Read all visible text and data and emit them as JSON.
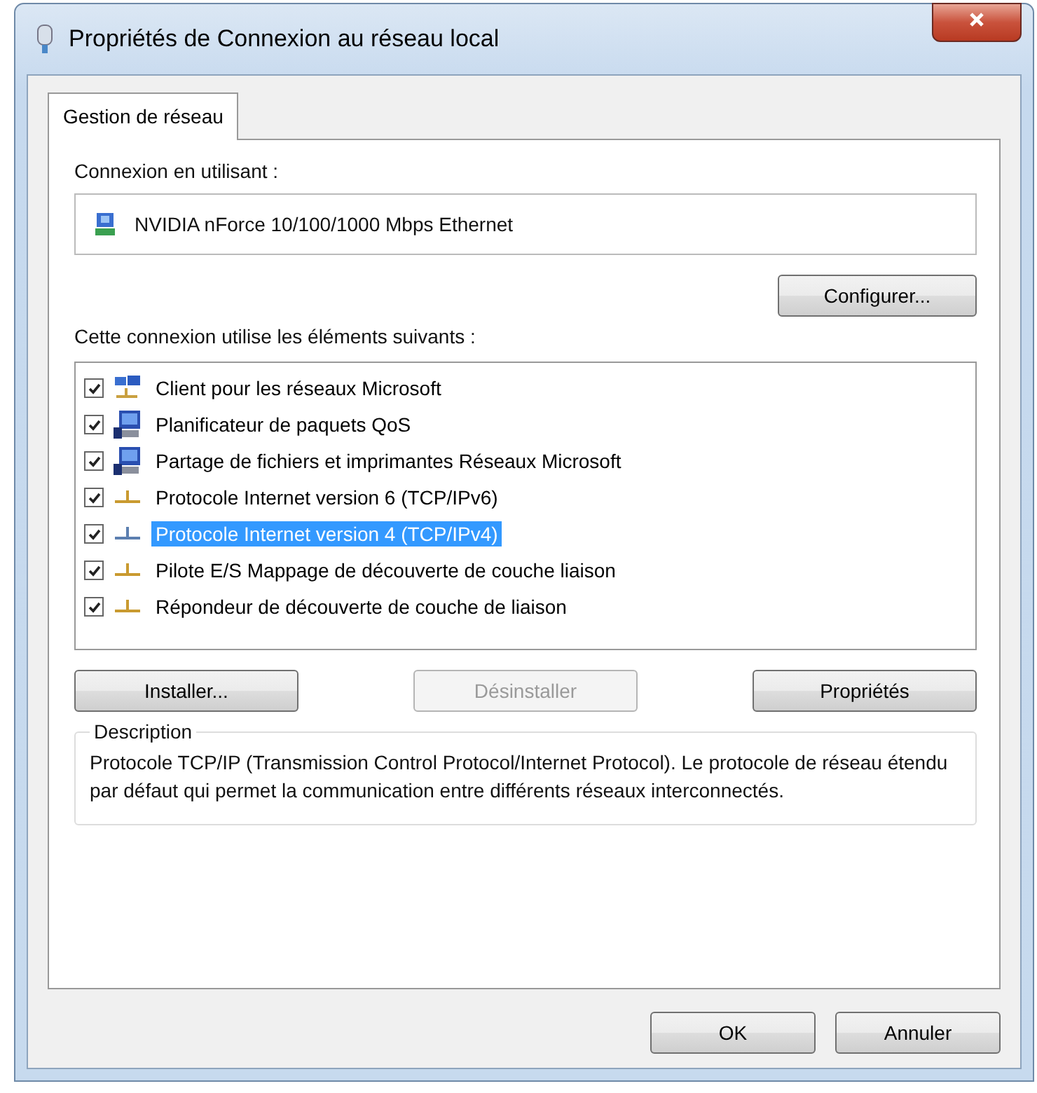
{
  "window": {
    "title": "Propriétés de Connexion au réseau local"
  },
  "tabs": [
    {
      "label": "Gestion de réseau",
      "selected": true
    }
  ],
  "connect_using": {
    "label": "Connexion en utilisant :",
    "adapter": "NVIDIA nForce 10/100/1000 Mbps Ethernet",
    "configure_button": "Configurer..."
  },
  "items_label": "Cette connexion utilise les éléments suivants :",
  "items": [
    {
      "label": "Client pour les réseaux Microsoft",
      "kind": "client",
      "checked": true,
      "selected": false
    },
    {
      "label": "Planificateur de paquets QoS",
      "kind": "service",
      "checked": true,
      "selected": false
    },
    {
      "label": "Partage de fichiers et imprimantes Réseaux Microsoft",
      "kind": "service",
      "checked": true,
      "selected": false
    },
    {
      "label": "Protocole Internet version 6 (TCP/IPv6)",
      "kind": "protocol",
      "checked": true,
      "selected": false
    },
    {
      "label": "Protocole Internet version 4 (TCP/IPv4)",
      "kind": "protocol",
      "checked": true,
      "selected": true
    },
    {
      "label": "Pilote E/S Mappage de découverte de couche liaison",
      "kind": "protocol",
      "checked": true,
      "selected": false
    },
    {
      "label": "Répondeur de découverte de couche de liaison",
      "kind": "protocol",
      "checked": true,
      "selected": false
    }
  ],
  "item_buttons": [
    {
      "label": "Installer...",
      "disabled": false
    },
    {
      "label": "Désinstaller",
      "disabled": true
    },
    {
      "label": "Propriétés",
      "disabled": false
    }
  ],
  "description": {
    "title": "Description",
    "text": "Protocole TCP/IP (Transmission Control Protocol/Internet Protocol). Le protocole de réseau étendu par défaut qui permet la communication entre différents réseaux interconnectés."
  },
  "dialog_buttons": [
    "OK",
    "Annuler"
  ]
}
